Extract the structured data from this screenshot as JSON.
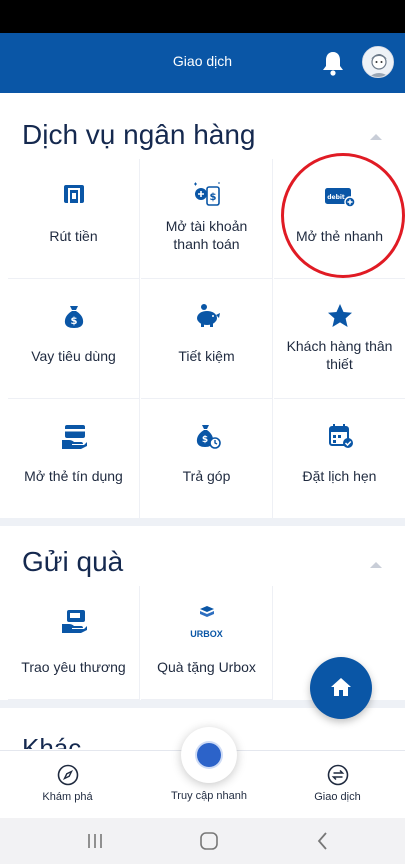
{
  "header": {
    "title": "Giao dịch",
    "bell_icon": "bell-icon",
    "avatar_icon": "avatar-icon"
  },
  "banking": {
    "title": "Dịch vụ ngân hàng",
    "items": [
      {
        "label": "Rút tiền",
        "icon": "atm-withdraw-icon"
      },
      {
        "label": "Mở tài khoản thanh toán",
        "icon": "open-account-icon"
      },
      {
        "label": "Mở thẻ nhanh",
        "icon": "debit-card-add-icon"
      },
      {
        "label": "Vay tiêu dùng",
        "icon": "money-bag-icon"
      },
      {
        "label": "Tiết kiệm",
        "icon": "piggy-bank-icon"
      },
      {
        "label": "Khách hàng thân thiết",
        "icon": "star-icon"
      },
      {
        "label": "Mở thẻ tín dụng",
        "icon": "credit-card-hand-icon"
      },
      {
        "label": "Trả góp",
        "icon": "installment-bag-icon"
      },
      {
        "label": "Đặt lịch hẹn",
        "icon": "calendar-check-icon"
      }
    ]
  },
  "gifts": {
    "title": "Gửi quà",
    "items": [
      {
        "label": "Trao yêu thương",
        "icon": "gift-card-hand-icon"
      },
      {
        "label": "Quà tặng Urbox",
        "icon": "urbox-logo-icon",
        "logo_text": "URBOX"
      }
    ]
  },
  "peek_section": {
    "title": "Khác"
  },
  "bottom_nav": {
    "tabs": [
      {
        "label": "Khám phá",
        "icon": "compass-icon"
      },
      {
        "label": "Truy cập nhanh",
        "icon": "quick-access-icon"
      },
      {
        "label": "Giao dịch",
        "icon": "transfer-icon"
      }
    ]
  },
  "colors": {
    "brand": "#0a56a6",
    "highlight": "#e01b24",
    "title": "#15294f"
  }
}
